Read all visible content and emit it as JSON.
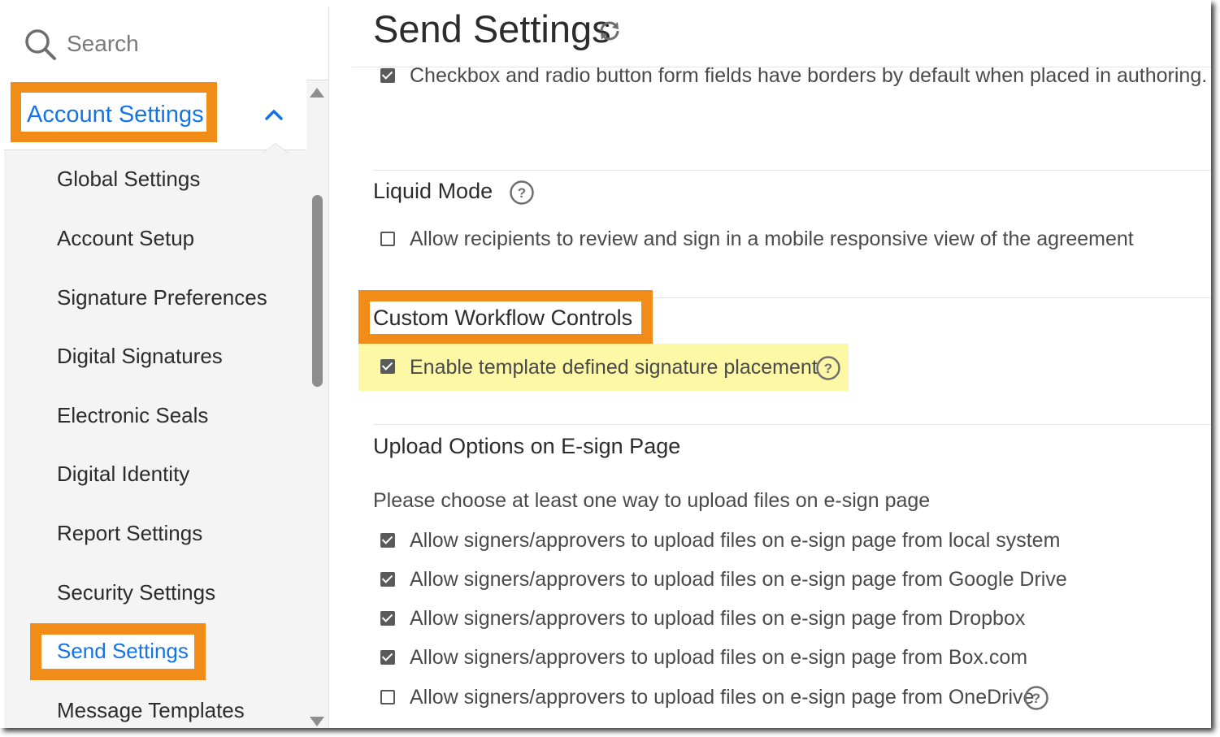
{
  "sidebar": {
    "search_placeholder": "Search",
    "section_label": "Account Settings",
    "items": [
      {
        "label": "Global Settings"
      },
      {
        "label": "Account Setup"
      },
      {
        "label": "Signature Preferences"
      },
      {
        "label": "Digital Signatures"
      },
      {
        "label": "Electronic Seals"
      },
      {
        "label": "Digital Identity"
      },
      {
        "label": "Report Settings"
      },
      {
        "label": "Security Settings"
      },
      {
        "label": "Send Settings",
        "active": true
      },
      {
        "label": "Message Templates"
      }
    ]
  },
  "main": {
    "title": "Send Settings",
    "top_option": {
      "label": "Checkbox and radio button form fields have borders by default when placed in authoring.",
      "checked": true
    },
    "liquid_mode": {
      "title": "Liquid Mode",
      "option": {
        "label": "Allow recipients to review and sign in a mobile responsive view of the agreement",
        "checked": false
      }
    },
    "custom_workflow": {
      "title": "Custom Workflow Controls",
      "option": {
        "label": "Enable template defined signature placement",
        "checked": true
      }
    },
    "upload_options": {
      "title": "Upload Options on E-sign Page",
      "description": "Please choose at least one way to upload files on e-sign page",
      "options": [
        {
          "label": "Allow signers/approvers to upload files on e-sign page from local system",
          "checked": true
        },
        {
          "label": "Allow signers/approvers to upload files on e-sign page from Google Drive",
          "checked": true
        },
        {
          "label": "Allow signers/approvers to upload files on e-sign page from Dropbox",
          "checked": true
        },
        {
          "label": "Allow signers/approvers to upload files on e-sign page from Box.com",
          "checked": true
        },
        {
          "label": "Allow signers/approvers to upload files on e-sign page from OneDrive",
          "checked": false
        }
      ]
    }
  },
  "colors": {
    "accent_blue": "#1473e6",
    "highlight_orange": "#f18c18",
    "highlight_yellow": "#fdf8a6"
  }
}
